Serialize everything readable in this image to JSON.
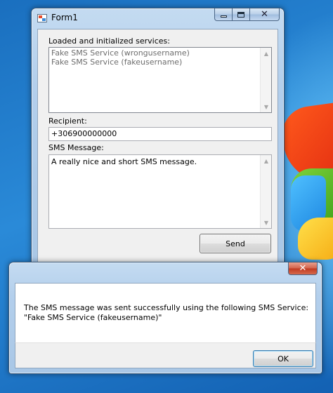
{
  "form1": {
    "title": "Form1",
    "services_label": "Loaded and initialized services:",
    "services": [
      "Fake SMS Service (wrongusername)",
      "Fake SMS Service (fakeusername)"
    ],
    "recipient_label": "Recipient:",
    "recipient_value": "+306900000000",
    "message_label": "SMS Message:",
    "message_value": "A really nice and short SMS message.",
    "send_label": "Send"
  },
  "message_box": {
    "line1": "The SMS message was sent successfully using the following SMS Service:",
    "line2": "\"Fake SMS Service (fakeusername)\"",
    "ok_label": "OK"
  },
  "icons": {
    "form_icon": "application-window-icon",
    "minimize": "minimize-icon",
    "maximize": "maximize-icon",
    "close": "close-icon"
  }
}
